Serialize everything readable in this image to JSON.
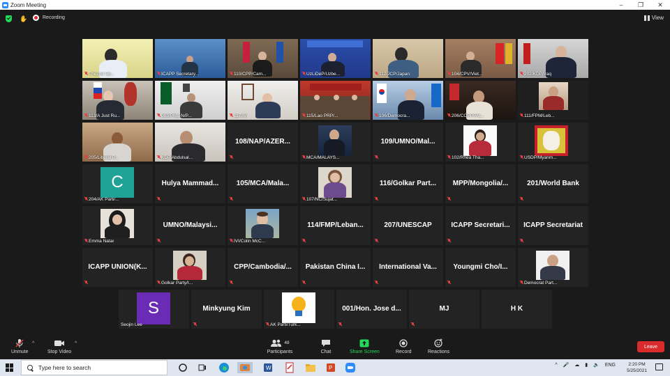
{
  "window": {
    "title": "Zoom Meeting"
  },
  "topbar": {
    "recording_label": "Recording",
    "view_label": "View"
  },
  "gallery": {
    "row1": [
      "The2nd Sp...",
      "ICAPP Secretary...",
      "110/CPP/Cam...",
      "UzLiDeP/Uzbe...",
      "112/JCP/Japan",
      "104/CPV/Viet...",
      "202/KDP/Iraq"
    ],
    "row2": [
      "113/A Just Ru...",
      "003/PML-N/P...",
      "117/IVI",
      "115/Lao PRP/...",
      "106/Democra...",
      "206/COPPPAL...",
      "111/FPM/Leb..."
    ],
    "row3": [
      "205/Liberal P...",
      "KDP Abdulsal...",
      "108/NAP/AZER...",
      "MCA/MALAYS...",
      "109/UMNO/Mal...",
      "102/Rhea Tha...",
      "USDP/Myanm..."
    ],
    "row4": [
      "204/AK Parti/...",
      "Hulya Mammad...",
      "105/MCA/Mala...",
      "107/NC/Sujat...",
      "116/Golkar Part...",
      "MPP/Mongolia/...",
      "201/World Bank"
    ],
    "row5": [
      "Emma Natar",
      "UMNO/Malaysi...",
      "IVI/Colin McC...",
      "114/FMP/Leban...",
      "207/UNESCAP",
      "ICAPP Secretari...",
      "ICAPP Secretariat"
    ],
    "row6": [
      "ICAPP UNION(K...",
      "Golkar Party/I...",
      "CPP/Cambodia/...",
      "Pakistan China I...",
      "International Va...",
      "Youngmi Cho/I...",
      "Democrat Part..."
    ],
    "row7": [
      "Seojin Lee",
      "Minkyung Kim",
      "AK Parti/Turk...",
      "001/Hon. Jose d...",
      "MJ",
      "H K"
    ],
    "avatar_letters": {
      "c": "C",
      "s": "S"
    }
  },
  "toolbar": {
    "unmute": "Unmute",
    "stop_video": "Stop Video",
    "participants": "Participants",
    "participants_count": "48",
    "chat": "Chat",
    "share_screen": "Share Screen",
    "record": "Record",
    "reactions": "Reactions",
    "leave": "Leave"
  },
  "taskbar": {
    "search_placeholder": "Type here to search",
    "lang": "ENG",
    "time": "2:20 PM",
    "date": "5/25/2021"
  },
  "colors": {
    "accent": "#2d8cff",
    "share_green": "#23d959",
    "leave_red": "#d92b2b",
    "active_speaker": "#c8e04a",
    "muted_red": "#e64040"
  }
}
